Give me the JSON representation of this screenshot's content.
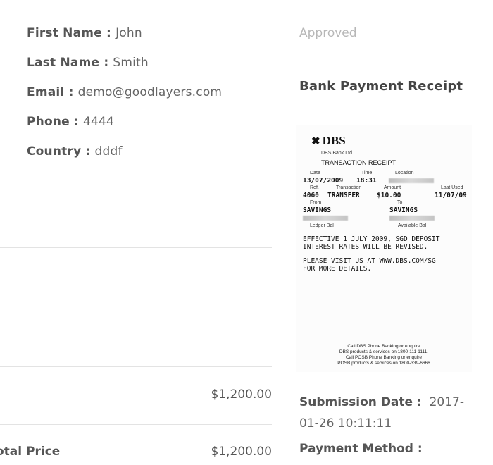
{
  "customer": {
    "first_name_label": "First Name :",
    "first_name": "John",
    "last_name_label": "Last Name :",
    "last_name": "Smith",
    "email_label": "Email :",
    "email": "demo@goodlayers.com",
    "phone_label": "Phone :",
    "phone": "4444",
    "country_label": "Country :",
    "country": "dddf"
  },
  "pricing": {
    "subtotal": "$1,200.00",
    "total_label": "otal Price",
    "total": "$1,200.00"
  },
  "status": "Approved",
  "receipt_section": {
    "title": "Bank Payment Receipt"
  },
  "receipt": {
    "bank_logo": "DBS",
    "bank_name": "DBS Bank Ltd",
    "heading": "TRANSACTION RECEIPT",
    "date_label": "Date",
    "date": "13/07/2009",
    "time_label": "Time",
    "time": "18:31",
    "location_label": "Location",
    "ref_label": "Ref.",
    "ref": "4060",
    "transaction_label": "Transaction",
    "transaction": "TRANSFER",
    "amount_label": "Amount",
    "amount": "$10.00",
    "last_used_label": "Last Used",
    "last_used": "11/07/09",
    "from_label": "From",
    "from": "SAVINGS",
    "to_label": "To",
    "to": "SAVINGS",
    "ledger_label": "Ledger Bal",
    "available_label": "Available Bal",
    "notice1_line1": "EFFECTIVE 1 JULY 2009, SGD DEPOSIT",
    "notice1_line2": "INTEREST RATES WILL BE REVISED.",
    "notice2_line1": "PLEASE VISIT US AT WWW.DBS.COM/SG",
    "notice2_line2": "FOR MORE DETAILS.",
    "footer_line1": "Call DBS Phone Banking or enquire",
    "footer_line2": "DBS products & services on 1800-111-1111.",
    "footer_line3": "Call POSB Phone Banking or enquire",
    "footer_line4": "POSB products & services on 1800-339-6666"
  },
  "submission": {
    "label": "Submission Date :",
    "value": "2017-01-26 10:11:11"
  },
  "payment_method": {
    "label": "Payment Method :"
  }
}
